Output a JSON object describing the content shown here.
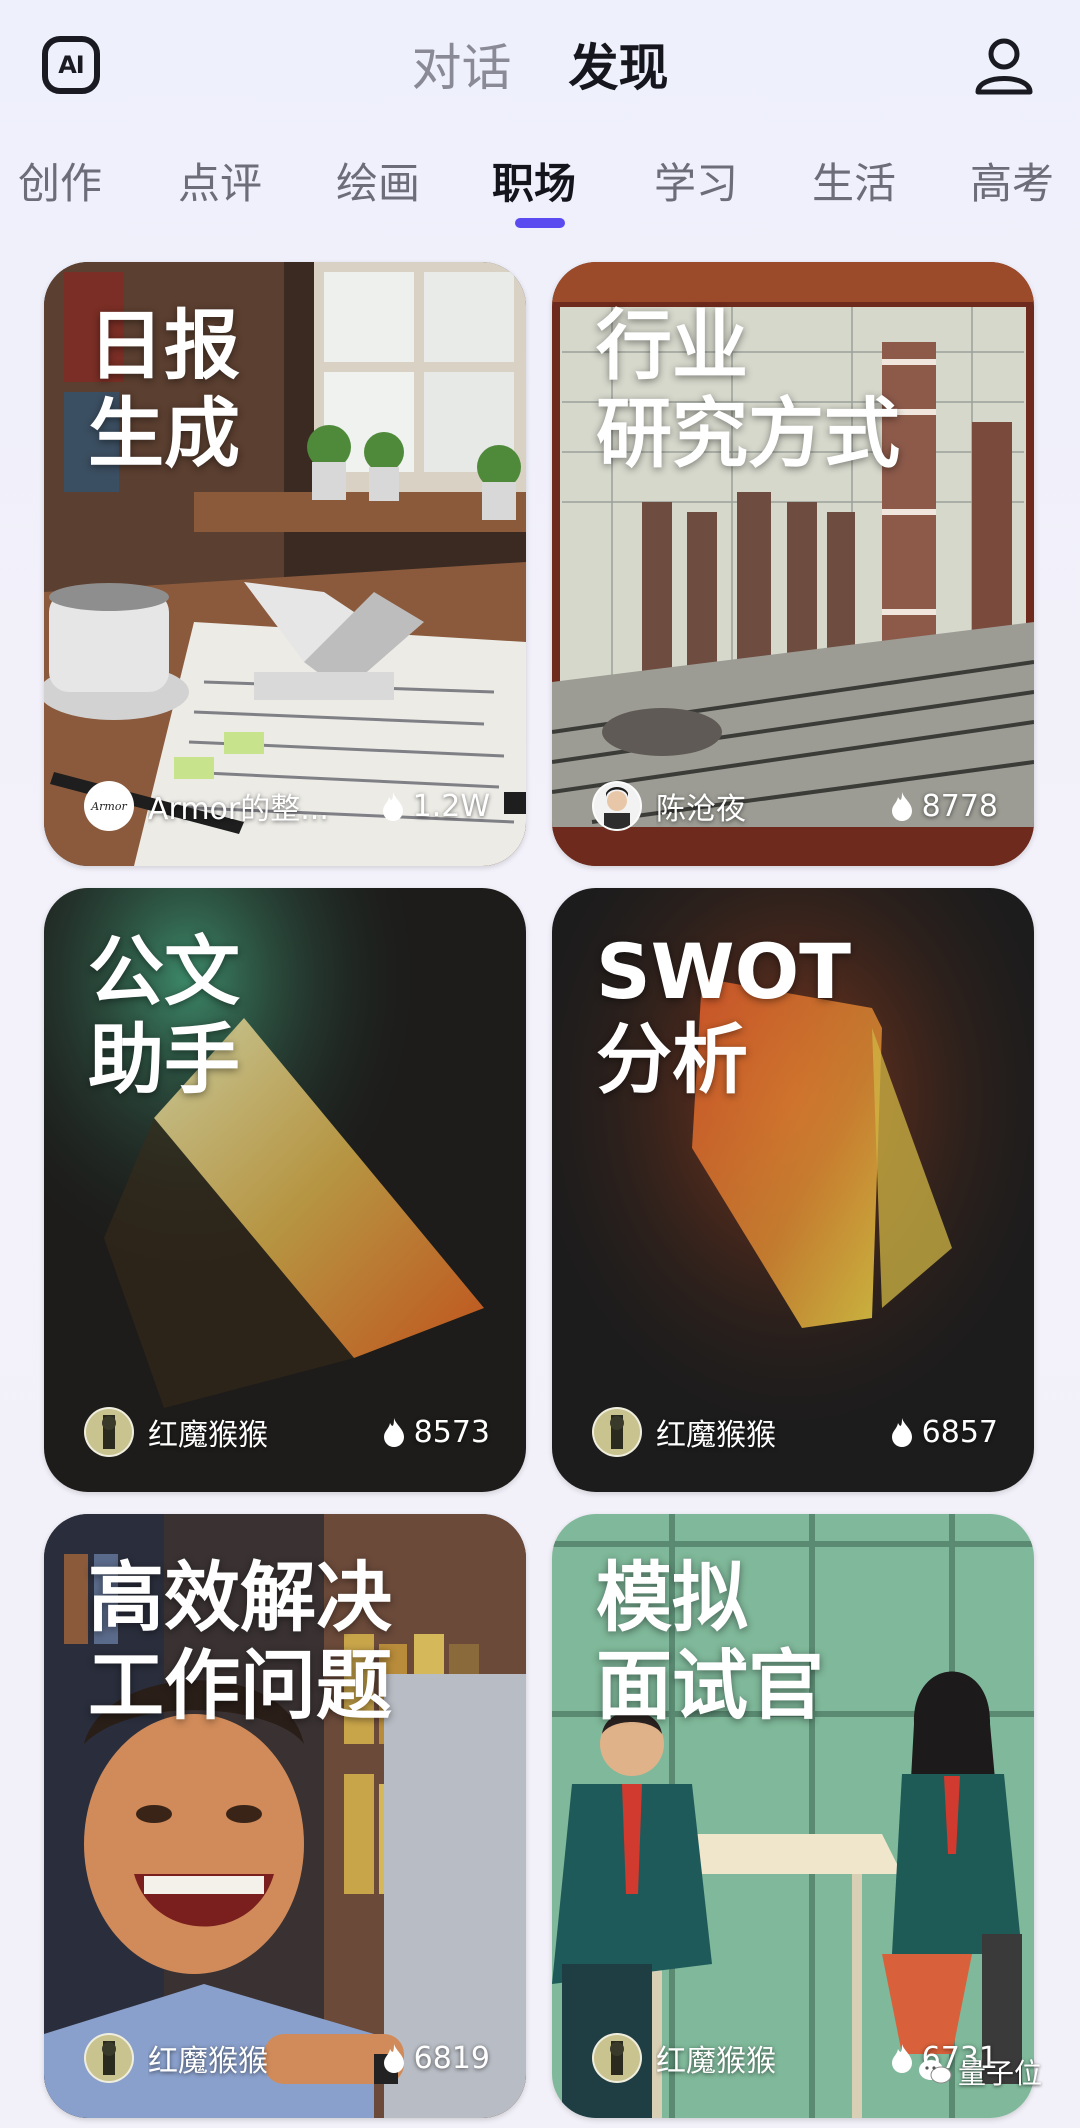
{
  "header": {
    "logo_text": "AI",
    "tabs": [
      {
        "label": "对话",
        "active": false
      },
      {
        "label": "发现",
        "active": true
      }
    ],
    "user_icon": "user-icon"
  },
  "categories": [
    {
      "label": "创作",
      "active": false
    },
    {
      "label": "点评",
      "active": false
    },
    {
      "label": "绘画",
      "active": false
    },
    {
      "label": "职场",
      "active": true
    },
    {
      "label": "学习",
      "active": false
    },
    {
      "label": "生活",
      "active": false
    },
    {
      "label": "高考",
      "active": false
    }
  ],
  "accent_color": "#5a4bf0",
  "cards": [
    {
      "title": "日报\n生成",
      "author": "Armor的整...",
      "heat": "1.2W",
      "avatar_text": "Armor"
    },
    {
      "title": "行业\n研究方式",
      "author": "陈沧夜",
      "heat": "8778"
    },
    {
      "title": "公文\n助手",
      "author": "红魔猴猴",
      "heat": "8573"
    },
    {
      "title": "SWOT\n分析",
      "author": "红魔猴猴",
      "heat": "6857"
    },
    {
      "title": "高效解决\n工作问题",
      "author": "红魔猴猴",
      "heat": "6819"
    },
    {
      "title": "模拟\n面试官",
      "author": "红魔猴猴",
      "heat": "6731"
    }
  ],
  "watermark": {
    "text": "量子位",
    "icon": "wechat-icon"
  }
}
